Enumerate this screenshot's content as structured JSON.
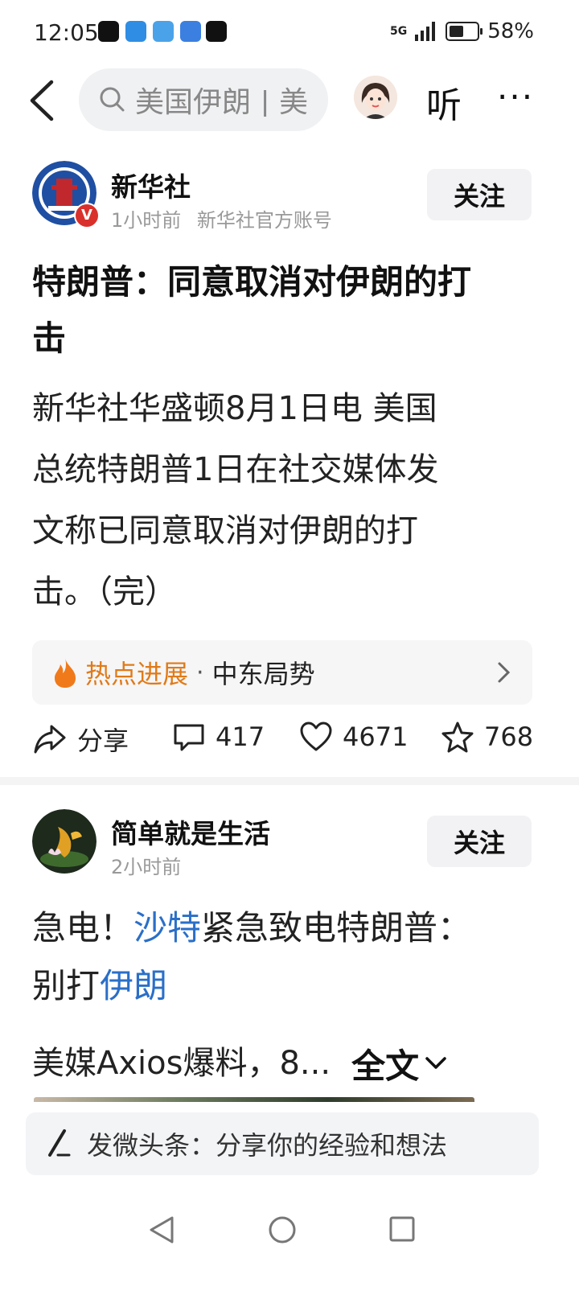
{
  "status_bar": {
    "time": "12:05",
    "network": "5G",
    "battery": "58%",
    "battery_level": 0.58
  },
  "top_nav": {
    "search_value": "美国伊朗 | 美",
    "listen_label": "听",
    "more_label": "···"
  },
  "post1": {
    "author": "新华社",
    "time": "1小时前",
    "account_desc": "新华社官方账号",
    "verified_badge": "V",
    "follow_label": "关注",
    "headline_line1": "特朗普：同意取消对伊朗的打",
    "headline_line2": "击",
    "body_lines": [
      "新华社华盛顿8月1日电 美国",
      "总统特朗普1日在社交媒体发",
      "文称已同意取消对伊朗的打",
      "击。（完）"
    ],
    "topic_label": "热点进展",
    "topic_sep": "·",
    "topic_text": "中东局势",
    "share_label": "分享",
    "comments": "417",
    "likes": "4671",
    "favorites": "768"
  },
  "post2": {
    "author": "简单就是生活",
    "time": "2小时前",
    "follow_label": "关注",
    "title_p1": "急电！",
    "title_link1": "沙特",
    "title_p2": "紧急致电特朗普：",
    "title_p3": "别打",
    "title_link2": "伊朗",
    "snippet": "美媒Axios爆料，8...",
    "full_label": "全文"
  },
  "composer": {
    "text": "发微头条：分享你的经验和想法"
  },
  "colors": {
    "accent_orange": "#e07a18",
    "link_blue": "#2a6fc8",
    "verified_red": "#d9302c"
  }
}
